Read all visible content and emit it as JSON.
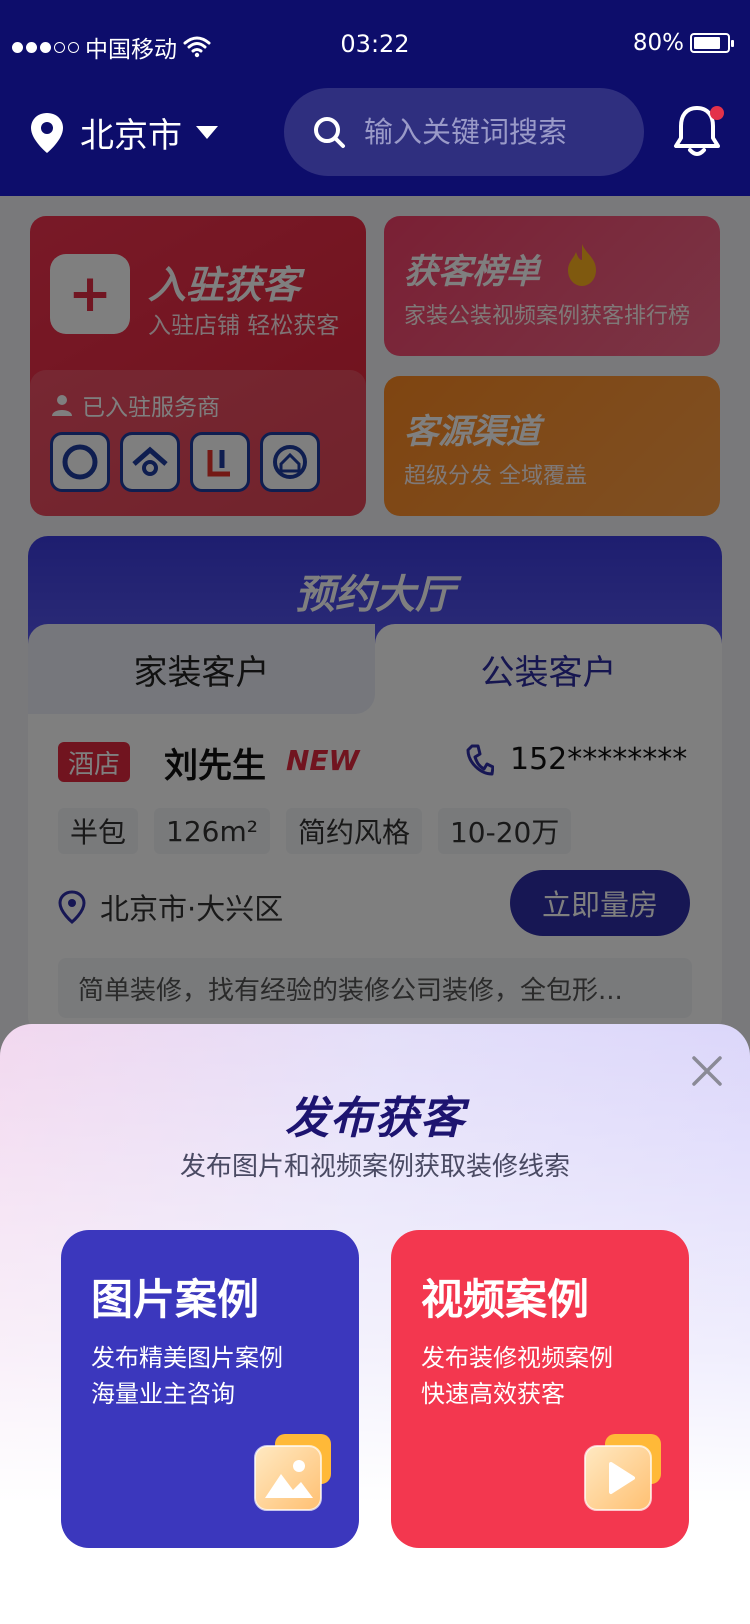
{
  "status_bar": {
    "carrier": "中国移动",
    "time": "03:22",
    "battery": "80%",
    "battery_level": 0.8
  },
  "header": {
    "city": "北京市",
    "search_placeholder": "输入关键词搜索"
  },
  "entry_card": {
    "title": "入驻获客",
    "subtitle": "入驻店铺  轻松获客",
    "providers_title": "已入驻服务商"
  },
  "rank_card": {
    "title": "获客榜单",
    "subtitle": "家装公装视频案例获客排行榜"
  },
  "channel_card": {
    "title": "客源渠道",
    "subtitle": "超级分发 全域覆盖"
  },
  "hall": {
    "title": "预约大厅",
    "tabs": [
      {
        "label": "家装客户"
      },
      {
        "label": "公装客户"
      }
    ],
    "customer": {
      "tag": "酒店",
      "name": "刘先生",
      "badge": "NEW",
      "phone": "152********",
      "chips": [
        "半包",
        "126m²",
        "简约风格",
        "10-20万"
      ],
      "address": "北京市·大兴区",
      "action": "立即量房",
      "description": "简单装修，找有经验的装修公司装修，全包形..."
    }
  },
  "sheet": {
    "title": "发布获客",
    "subtitle": "发布图片和视频案例获取装修线索",
    "options": [
      {
        "title": "图片案例",
        "line1": "发布精美图片案例",
        "line2": "海量业主咨询",
        "icon": "image-icon",
        "color": "#3b37bd"
      },
      {
        "title": "视频案例",
        "line1": "发布装修视频案例",
        "line2": "快速高效获客",
        "icon": "play-video-icon",
        "color": "#f3374f"
      }
    ]
  },
  "colors": {
    "header_bg": "#0d0d6b",
    "accent_red": "#e2283e",
    "accent_blue": "#2f2fa8"
  }
}
